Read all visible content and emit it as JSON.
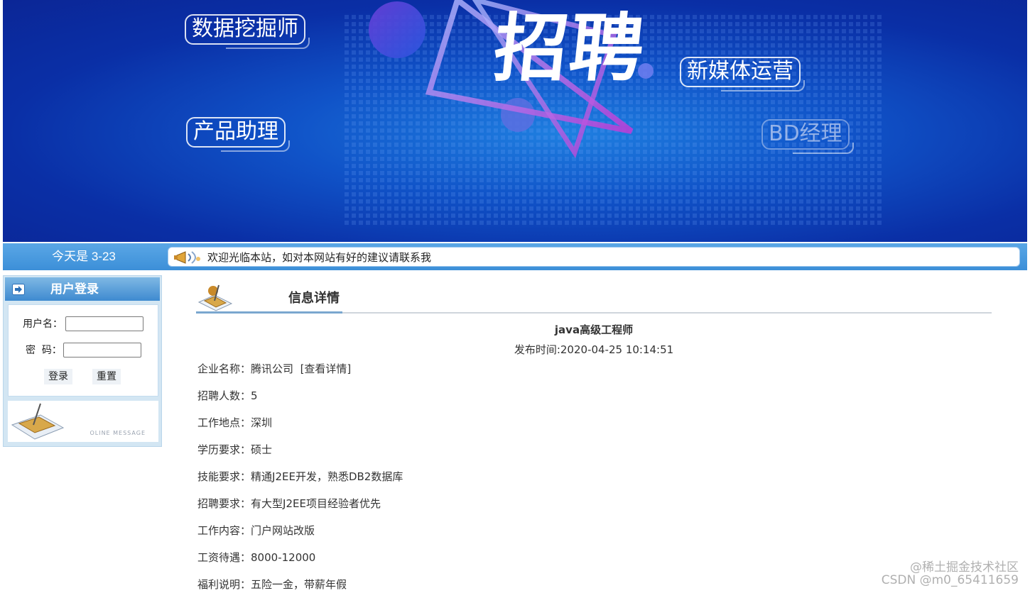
{
  "banner": {
    "headline": "招聘",
    "tags": [
      "数据挖掘师",
      "产品助理",
      "新媒体运营",
      "BD经理"
    ]
  },
  "notice_bar": {
    "date": "今天是 3-23",
    "message": "欢迎光临本站，如对本网站有好的建议请联系我"
  },
  "login": {
    "title": "用户登录",
    "username_label": "用户名：",
    "password_label": "密  码：",
    "login_button": "登录",
    "reset_button": "重置",
    "footer_caption": "OLINE MESSAGE"
  },
  "detail": {
    "section_title": "信息详情",
    "job_title": "java高级工程师",
    "publish_label": "发布时间:",
    "publish_time": "2020-04-25 10:14:51",
    "company": {
      "label": "企业名称：",
      "value": "腾讯公司",
      "link": "[查看详情]"
    },
    "rows": [
      {
        "label": "招聘人数：",
        "value": "5"
      },
      {
        "label": "工作地点：",
        "value": "深圳"
      },
      {
        "label": "学历要求：",
        "value": "硕士"
      },
      {
        "label": "技能要求：",
        "value": "精通J2EE开发，熟悉DB2数据库"
      },
      {
        "label": "招聘要求：",
        "value": "有大型J2EE项目经验者优先"
      },
      {
        "label": "工作内容：",
        "value": "门户网站改版"
      },
      {
        "label": "工资待遇：",
        "value": "8000-12000"
      },
      {
        "label": "福利说明：",
        "value": "五险一金，带薪年假"
      }
    ]
  },
  "watermark": {
    "line1": "@稀土掘金技术社区",
    "line2": "CSDN @m0_65411659"
  }
}
